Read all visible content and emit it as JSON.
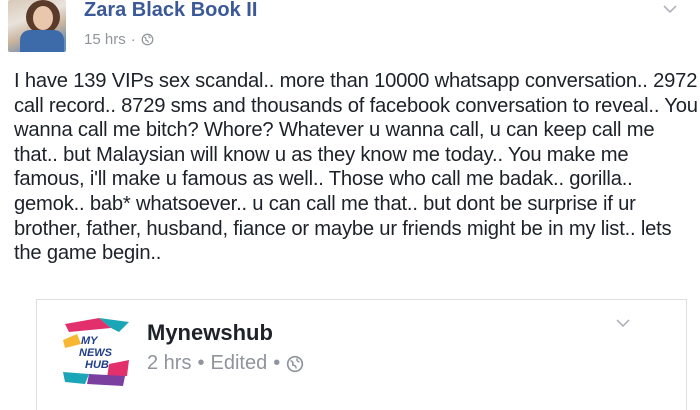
{
  "post": {
    "author": "Zara Black Book II",
    "time": "15 hrs",
    "separator": "·",
    "body": "I have 139 VIPs sex scandal.. more than 10000 whatsapp conversation.. 2972 call record.. 8729 sms and thousands of facebook conversation to reveal.. You wanna call me bitch? Whore? Whatever u wanna call, u can keep call me that.. but Malaysian will know u as they know me today.. You make me famous, i'll make u famous as well.. Those who call me badak.. gorilla.. gemok.. bab* whatsoever.. u can call me that.. but dont be surprise if ur brother, father, husband, fiance or maybe ur friends might be in my list.. lets the game begin.."
  },
  "shared": {
    "page_name": "Mynewshub",
    "time": "2 hrs",
    "bullet1": "•",
    "edited": "Edited",
    "bullet2": "•",
    "logo_text": "MY NEWS HUB"
  },
  "colors": {
    "author": "#3b5998",
    "meta": "#90949c",
    "text": "#1d2129"
  },
  "icons": [
    "globe-icon",
    "chevron-down-icon"
  ]
}
